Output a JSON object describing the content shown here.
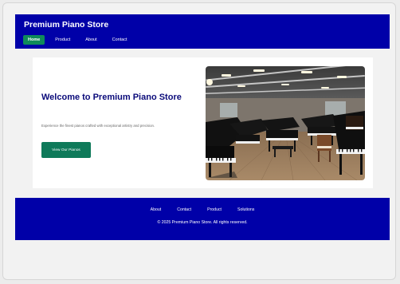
{
  "header": {
    "brand": "Premium Piano Store",
    "nav": [
      {
        "label": "Home",
        "active": true
      },
      {
        "label": "Product",
        "active": false
      },
      {
        "label": "About",
        "active": false
      },
      {
        "label": "Contact",
        "active": false
      }
    ]
  },
  "hero": {
    "title": "Welcome to Premium Piano Store",
    "subtitle": "Experience the finest pianos crafted with exceptional artistry and precision.",
    "cta_label": "View Our Pianos"
  },
  "footer": {
    "links": [
      "About",
      "Contact",
      "Product",
      "Solutions"
    ],
    "copyright": "© 2025 Premium Piano Store. All rights reserved."
  },
  "colors": {
    "brand_blue": "#0000a8",
    "accent_green": "#0f8a5a",
    "title_navy": "#0b0b7a"
  }
}
